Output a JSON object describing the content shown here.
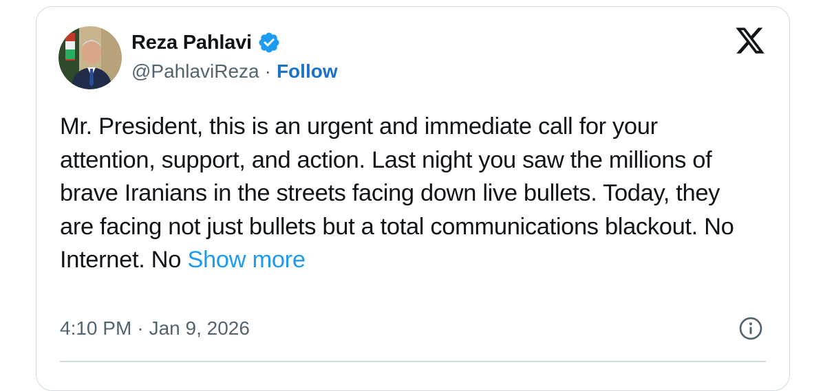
{
  "author": {
    "name": "Reza Pahlavi",
    "handle": "@PahlaviReza",
    "separator": "·",
    "follow_label": "Follow",
    "verified_icon": "verified-badge-icon"
  },
  "brand_icon": "x-logo-icon",
  "tweet": {
    "text": "Mr. President, this is an urgent and immediate call for your attention, support, and action. Last night you saw the millions of brave Iranians in the streets facing down live bullets. Today, they are facing not just bullets but a total communications blackout. No Internet. No ",
    "show_more_label": "Show more"
  },
  "meta": {
    "time": "4:10 PM",
    "separator": "·",
    "date": "Jan 9, 2026",
    "info_icon": "info-icon"
  },
  "colors": {
    "link": "#1d9bf0",
    "follow": "#1a73c8",
    "verified": "#1d9bf0",
    "text": "#0f1419",
    "secondary": "#536471",
    "border": "#cfd9de"
  }
}
